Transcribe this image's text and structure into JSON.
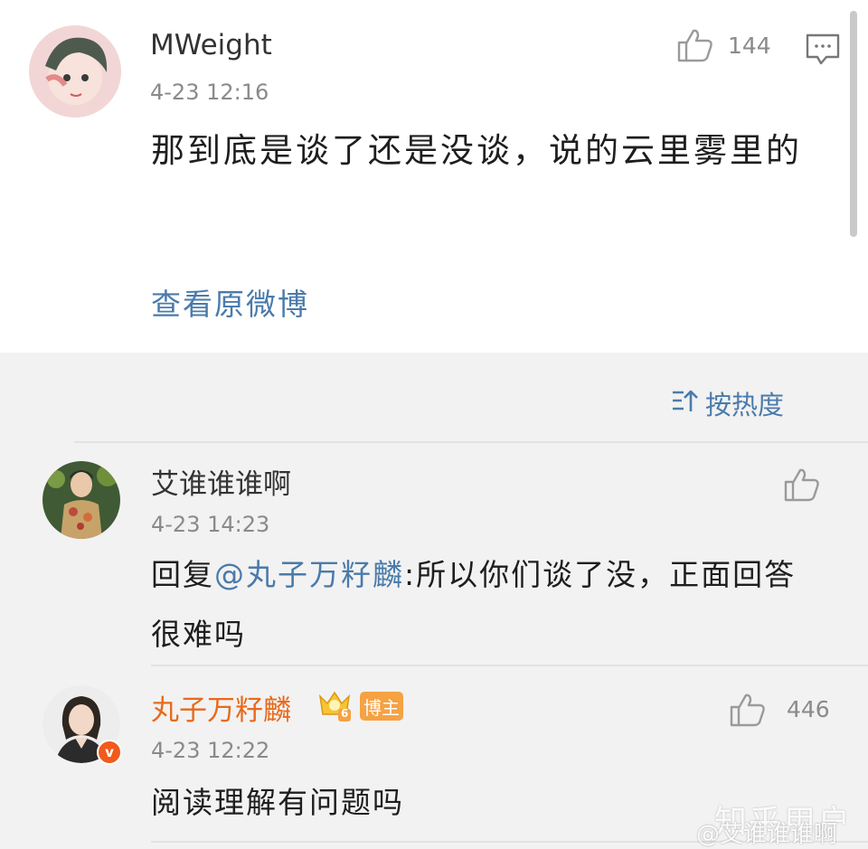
{
  "main_comment": {
    "username": "MWeight",
    "timestamp": "4-23 12:16",
    "like_count": "144",
    "text": "那到底是谈了还是没谈，说的云里雾里的",
    "view_original_label": "查看原微博"
  },
  "sort": {
    "label": "按热度"
  },
  "replies": [
    {
      "username": "艾谁谁谁啊",
      "timestamp": "4-23 14:23",
      "text_prefix": "回复",
      "mention": "@丸子万籽麟",
      "text_body": ":所以你们谈了没，正面回答很难吗",
      "like_count": ""
    },
    {
      "username": "丸子万籽麟",
      "vip_level": "6",
      "host_badge": "博主",
      "timestamp": "4-23 12:22",
      "text": "阅读理解有问题吗",
      "like_count": "446"
    }
  ],
  "watermark": {
    "text": "知乎用户",
    "sub": "@艾谁谁谁啊"
  },
  "colors": {
    "link": "#4a7bab",
    "host_name": "#e86a1c",
    "host_badge": "#f5a243"
  }
}
